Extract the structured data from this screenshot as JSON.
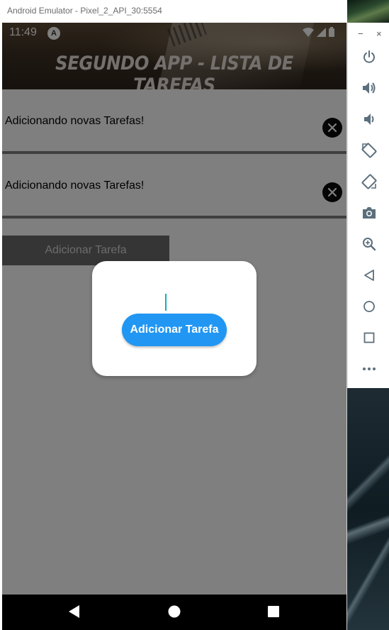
{
  "window": {
    "title": "Android Emulator - Pixel_2_API_30:5554"
  },
  "status_bar": {
    "time": "11:49",
    "app_icon_letter": "A"
  },
  "app": {
    "title": "SEGUNDO APP - LISTA DE TAREFAS",
    "tasks": [
      {
        "label": "Adicionando novas Tarefas!"
      },
      {
        "label": "Adicionando novas Tarefas!"
      }
    ],
    "add_button_label": "Adicionar Tarefa"
  },
  "dialog": {
    "input_value": "",
    "button_label": "Adicionar Tarefa"
  },
  "toolbar": {
    "window_controls": [
      "−",
      "×"
    ],
    "buttons": [
      "power-icon",
      "volume-up-icon",
      "volume-down-icon",
      "rotate-left-icon",
      "rotate-right-icon",
      "camera-icon",
      "zoom-icon",
      "back-icon",
      "home-icon",
      "overview-icon",
      "more-icon"
    ]
  },
  "colors": {
    "accent_button": "#2196f3",
    "delete_button": "#0b0b0b",
    "overlay": "#000000",
    "toolbar_icon": "#5c6f7c"
  }
}
